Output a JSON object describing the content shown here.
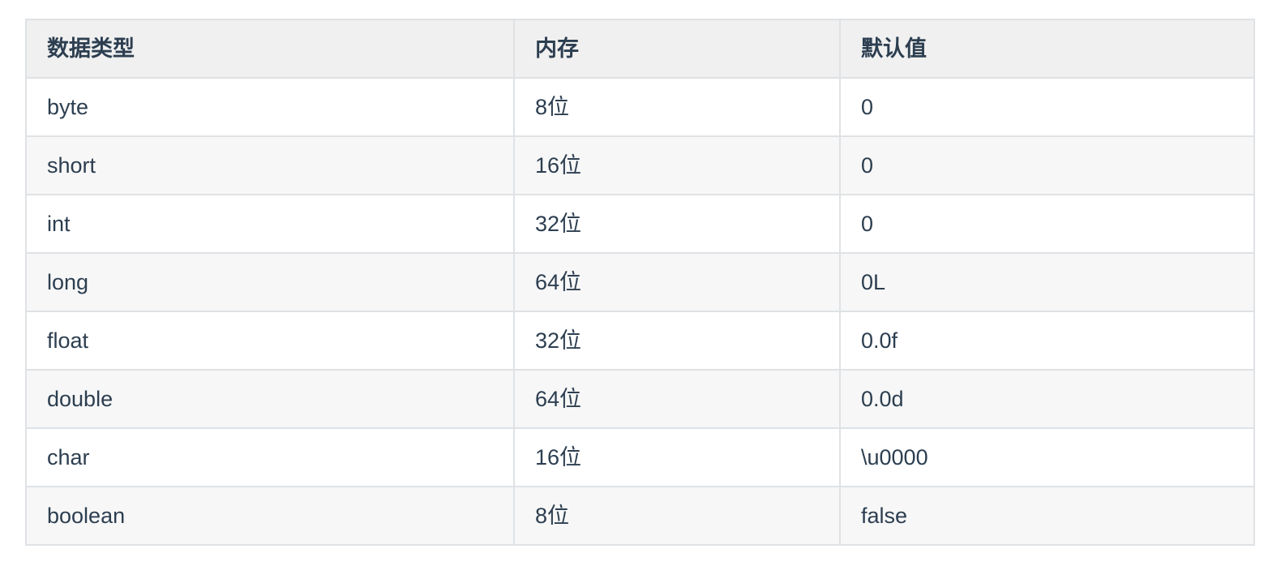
{
  "table": {
    "headers": [
      "数据类型",
      "内存",
      "默认值"
    ],
    "rows": [
      [
        "byte",
        "8位",
        "0"
      ],
      [
        "short",
        "16位",
        "0"
      ],
      [
        "int",
        "32位",
        "0"
      ],
      [
        "long",
        "64位",
        "0L"
      ],
      [
        "float",
        "32位",
        "0.0f"
      ],
      [
        "double",
        "64位",
        "0.0d"
      ],
      [
        "char",
        "16位",
        "\\u0000"
      ],
      [
        "boolean",
        "8位",
        "false"
      ]
    ]
  }
}
